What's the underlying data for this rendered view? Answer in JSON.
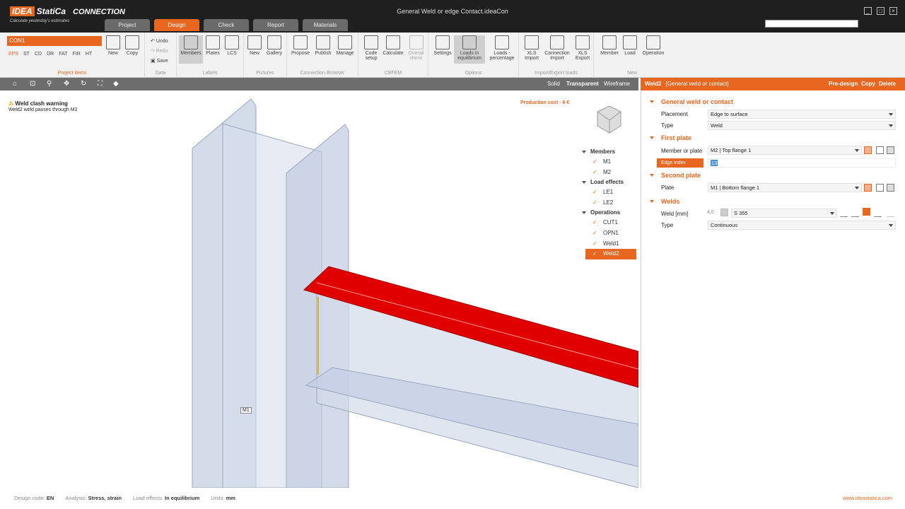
{
  "window": {
    "title": "General Weld or edge Contact.ideaCon"
  },
  "logo": {
    "brand_a": "IDEA",
    "brand_b": "StatiCa",
    "app": "CONNECTION",
    "tagline": "Calculate yesterday's estimates"
  },
  "tabs": [
    "Project",
    "Design",
    "Check",
    "Report",
    "Materials"
  ],
  "ribbon": {
    "connection": "CON1",
    "load_cases": [
      "EPS",
      "ST",
      "CD",
      "DR",
      "FAT",
      "FIR",
      "HT"
    ],
    "project_items_buttons": [
      "New",
      "Copy"
    ],
    "project_items_label": "Project items",
    "data_buttons": [
      "Undo",
      "Redo",
      "Save"
    ],
    "data_label": "Data",
    "labels_buttons": [
      "Members",
      "Plates",
      "LCS"
    ],
    "labels_label": "Labels",
    "pictures_buttons": [
      "New",
      "Gallery"
    ],
    "pictures_label": "Pictures",
    "browser_buttons": [
      "Propose",
      "Publish",
      "Manage"
    ],
    "browser_label": "Connection Browser",
    "cbfem_buttons": [
      "Code setup",
      "Calculate",
      "Overall check"
    ],
    "cbfem_label": "CBFEM",
    "options_buttons": [
      "Settings",
      "Loads in equilibrium",
      "Loads - percentage"
    ],
    "options_label": "Options",
    "ie_buttons": [
      "XLS Import",
      "Connection Import",
      "XLS Export"
    ],
    "ie_label": "Import/Export loads",
    "new_buttons": [
      "Member",
      "Load",
      "Operation"
    ],
    "new_label": "New"
  },
  "viewbar": {
    "modes": [
      "Solid",
      "Transparent",
      "Wireframe"
    ]
  },
  "warning": {
    "title": "Weld clash warning",
    "text": "Weld2 weld passes through M2"
  },
  "cost": "Production cost  -  6 €",
  "tree": {
    "members_label": "Members",
    "members": [
      "M1",
      "M2"
    ],
    "loads_label": "Load effects",
    "loads": [
      "LE1",
      "LE2"
    ],
    "ops_label": "Operations",
    "ops": [
      "CUT1",
      "OPN1",
      "Weld1",
      "Weld2"
    ]
  },
  "m1_label": "M1",
  "panel": {
    "name": "Weld2",
    "subtitle": "[General weld or contact]",
    "actions": [
      "Pre-design",
      "Copy",
      "Delete"
    ],
    "sec_general": "General weld or contact",
    "placement_label": "Placement",
    "placement": "Edge to surface",
    "type_label": "Type",
    "type": "Weld",
    "sec_first": "First plate",
    "member_label": "Member or plate",
    "member": "M2 | Top flange 1",
    "edge_label": "Edge index",
    "edge": "13",
    "sec_second": "Second plate",
    "plate_label": "Plate",
    "plate": "M1 | Bottom flange 1",
    "sec_welds": "Welds",
    "weld_label": "Weld [mm]",
    "weld_size": "4,0",
    "weld_material": "S 355",
    "weld_type_label": "Type",
    "weld_type": "Continuous"
  },
  "status": {
    "design_code_label": "Design code:",
    "design_code": "EN",
    "analysis_label": "Analysis:",
    "analysis": "Stress, strain",
    "load_label": "Load effects:",
    "load": "In equilibrium",
    "units_label": "Units:",
    "units": "mm",
    "url": "www.ideastatica.com"
  },
  "colors": {
    "accent": "#e8661f",
    "beam_red": "#e00000"
  }
}
